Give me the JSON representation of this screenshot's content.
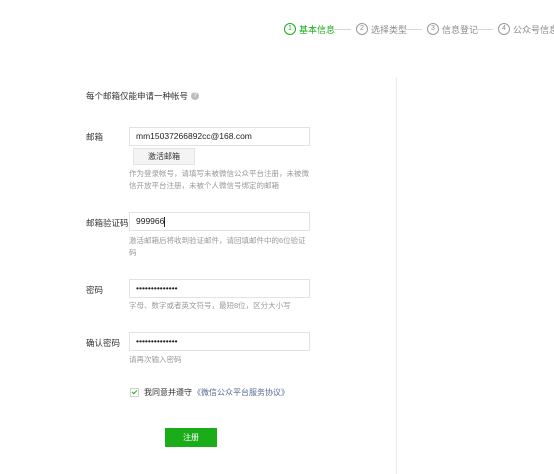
{
  "steps": [
    {
      "num": "1",
      "label": "基本信息",
      "active": true
    },
    {
      "num": "2",
      "label": "选择类型",
      "active": false
    },
    {
      "num": "3",
      "label": "信息登记",
      "active": false
    },
    {
      "num": "4",
      "label": "公众号信息",
      "active": false
    }
  ],
  "notice": {
    "text": "每个邮箱仅能申请一种帐号",
    "help_icon": "question-circle"
  },
  "email": {
    "label": "邮箱",
    "value": "mm15037266892cc@168.com",
    "activate_button": "激活邮箱",
    "tip": "作为登录帐号，请填写未被微信公众平台注册，未被微信开放平台注册，未被个人微信号绑定的邮箱"
  },
  "code": {
    "label": "邮箱验证码",
    "value": "999966",
    "tip": "激活邮箱后将收到验证邮件，请回填邮件中的6位验证码"
  },
  "password": {
    "label": "密码",
    "value": "••••••••••••••",
    "tip": "字母、数字或者英文符号，最短8位，区分大小写"
  },
  "confirm_password": {
    "label": "确认密码",
    "value": "••••••••••••••",
    "tip": "请再次输入密码"
  },
  "agreement": {
    "prefix": "我同意并遵守",
    "link": "《微信公众平台服务协议》",
    "checked": true
  },
  "register_button": "注册",
  "colors": {
    "accent": "#1aad19",
    "link": "#576b95",
    "tip": "#9a9a9a"
  }
}
